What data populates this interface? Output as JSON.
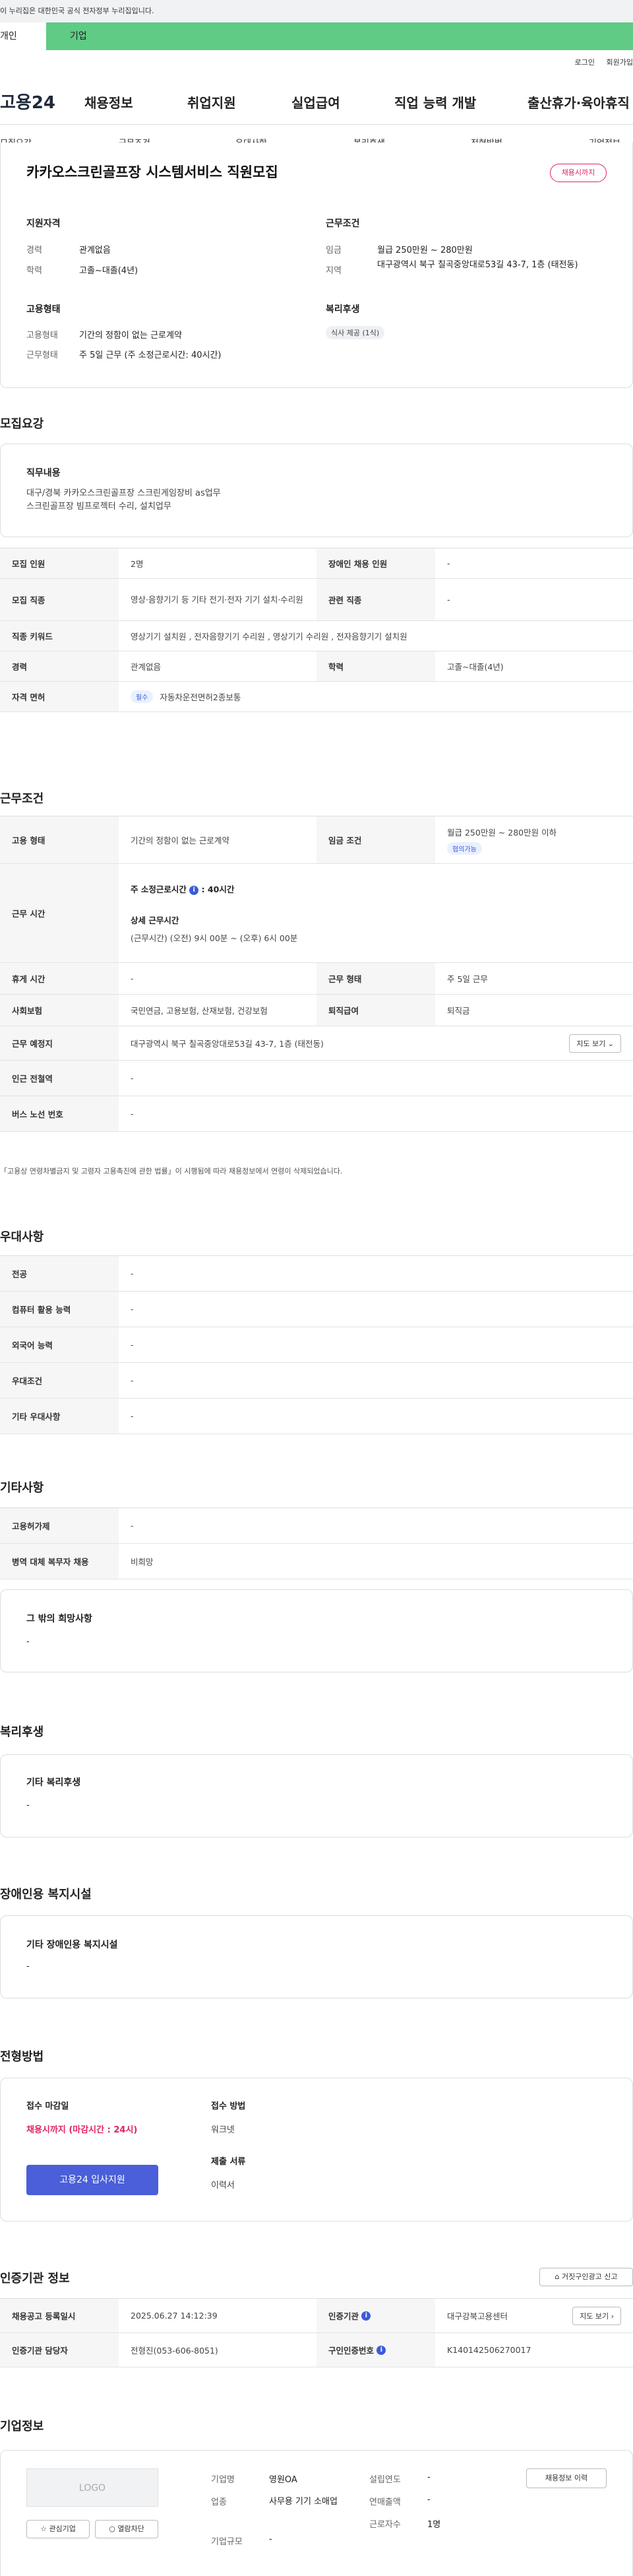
{
  "gov_banner": "이 누리집은 대한민국 공식 전자정부 누리집입니다.",
  "top_tabs": {
    "personal": "개인",
    "company": "기업"
  },
  "util_links": [
    "로그인",
    "회원가입"
  ],
  "logo": "고용24",
  "gnb": [
    "채용정보",
    "취업지원",
    "실업급여",
    "직업 능력 개발",
    "출산휴가·육아휴직"
  ],
  "snb": [
    "모집요강",
    "근무조건",
    "우대사항",
    "복리후생",
    "전형방법",
    "기업정보"
  ],
  "summary": {
    "title": "카카오스크린골프장 시스템서비스 직원모집",
    "badge": "채용시까지",
    "qual_title": "지원자격",
    "career_label": "경력",
    "career_value": "관계없음",
    "edu_label": "학력",
    "edu_value": "고졸~대졸(4년)",
    "emp_title": "고용형태",
    "emp_type_label": "고용형태",
    "emp_type_value": "기간의 정함이 없는 근로계약",
    "work_type_label": "근무형태",
    "work_type_value": "주 5일 근무 (주 소정근로시간: 40시간)",
    "cond_title": "근무조건",
    "wage_label": "임금",
    "wage_value": "월급 250만원 ~ 280만원",
    "area_label": "지역",
    "area_value": "대구광역시 북구 칠곡중앙대로53길 43-7, 1층 (태전동)",
    "welfare_title": "복리후생",
    "welfare_tag": "식사 제공 (1식)"
  },
  "recruit": {
    "title": "모집요강",
    "duty_title": "직무내용",
    "duty_text": "대구/경북 카카오스크린골프장 스크린게임장비 as업무\n스크린골프장 빔프로젝터 수리, 설치업무",
    "rows": {
      "headcount_label": "모집 인원",
      "headcount_value": "2명",
      "disabled_label": "장애인 채용 인원",
      "disabled_value": "-",
      "job_label": "모집 직종",
      "job_value": "영상·음향기기 등 기타 전기·전자 기기 설치·수리원",
      "related_label": "관련 직종",
      "related_value": "-",
      "keyword_label": "직종 키워드",
      "keyword_value": "영상기기 설치원 , 전자음향기기 수리원 , 영상기기 수리원 , 전자음향기기 설치원",
      "career_label": "경력",
      "career_value": "관계없음",
      "edu_label": "학력",
      "edu_value": "고졸~대졸(4년)",
      "license_label": "자격 면허",
      "license_tag": "필수",
      "license_value": "자동차운전면허2종보통"
    }
  },
  "work": {
    "title": "근무조건",
    "emp_label": "고용 형태",
    "emp_value": "기간의 정함이 없는 근로계약",
    "wage_label": "임금 조건",
    "wage_value": "월급 250만원 ~ 280만원 이하",
    "wage_tag": "협의가능",
    "hours_label": "근무 시간",
    "hours_weekly": "주 소정근로시간",
    "hours_weekly_value": ": 40시간",
    "hours_detail_title": "상세 근무시간",
    "hours_detail": "(근무시간) (오전) 9시 00분 ~ (오후) 6시 00분",
    "rest_label": "휴게 시간",
    "rest_value": "-",
    "worktype_label": "근무 형태",
    "worktype_value": "주 5일 근무",
    "insurance_label": "사회보험",
    "insurance_value": "국민연금, 고용보험, 산재보험, 건강보험",
    "severance_label": "퇴직급여",
    "severance_value": "퇴직금",
    "location_label": "근무 예정지",
    "location_value": "대구광역시 북구 칠곡중앙대로53길 43-7, 1층 (태전동)",
    "map_button": "지도 보기",
    "subway_label": "인근 전철역",
    "subway_value": "-",
    "bus_label": "버스 노선 번호",
    "bus_value": "-",
    "note": "「고용상 연령차별금지 및 고령자 고용촉진에 관한 법률」이 시행됨에 따라 채용정보에서 연령이 삭제되었습니다."
  },
  "prefer": {
    "title": "우대사항",
    "rows": [
      {
        "label": "전공",
        "value": "-"
      },
      {
        "label": "컴퓨터 활용 능력",
        "value": "-"
      },
      {
        "label": "외국어 능력",
        "value": "-"
      },
      {
        "label": "우대조건",
        "value": "-"
      },
      {
        "label": "기타 우대사항",
        "value": "-"
      }
    ]
  },
  "etc": {
    "title": "기타사항",
    "rows": [
      {
        "label": "고용허가제",
        "value": "-"
      },
      {
        "label": "병역 대체 복무자 채용",
        "value": "비희망"
      }
    ],
    "other_title": "그 밖의 희망사항",
    "other_value": "-"
  },
  "welfare": {
    "title": "복리후생",
    "box_title": "기타 복리후생",
    "box_value": "-"
  },
  "disabled": {
    "title": "장애인용 복지시설",
    "box_title": "기타 장애인용 복지시설",
    "box_value": "-"
  },
  "selection": {
    "title": "전형방법",
    "deadline_title": "접수 마감일",
    "deadline_value": "채용시까지 (마감시간 : 24시)",
    "apply_button": "고용24 입사지원",
    "method_title": "접수 방법",
    "method_value": "워크넷",
    "docs_title": "제출 서류",
    "docs_value": "이력서"
  },
  "agency": {
    "title": "인증기관 정보",
    "report_button": "거짓구인광고 신고",
    "reg_label": "채용공고 등록일시",
    "reg_value": "2025.06.27 14:12:39",
    "agency_label": "인증기관",
    "agency_value": "대구강북고용센터",
    "map_button": "지도 보기",
    "manager_label": "인증기관 담당자",
    "manager_value": "전형진(053-606-8051)",
    "certno_label": "구인인증번호",
    "certno_value": "K140142506270017"
  },
  "company": {
    "title": "기업정보",
    "logo_text": "LOGO",
    "fav_button": "관심기업",
    "block_button": "열람차단",
    "name_label": "기업명",
    "name_value": "영원OA",
    "industry_label": "업종",
    "industry_value": "사무용 기기 소매업",
    "size_label": "기업규모",
    "size_value": "-",
    "founded_label": "설립연도",
    "founded_value": "-",
    "revenue_label": "연매출액",
    "revenue_value": "-",
    "employees_label": "근로자수",
    "employees_value": "1명",
    "history_button": "채용정보 이력"
  }
}
